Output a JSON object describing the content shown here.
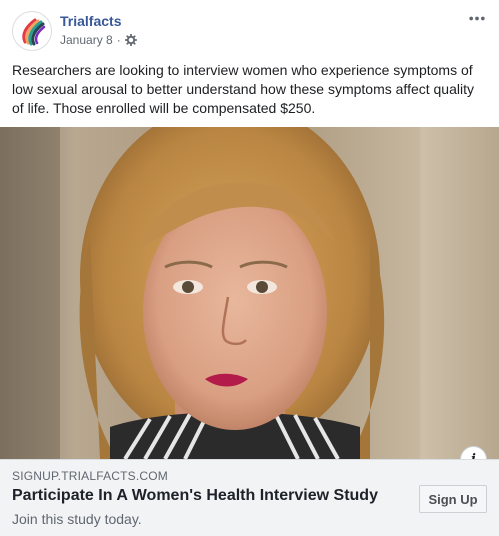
{
  "post": {
    "page_name": "Trialfacts",
    "date": "January 8",
    "separator": "·",
    "privacy_icon": "gear-icon",
    "more_icon": "more-options-icon",
    "text": "Researchers are looking to interview women who experience symptoms of low sexual arousal to better understand how these symptoms affect quality of life. Those enrolled will be compensated $250."
  },
  "image": {
    "subject": "woman-portrait-photo",
    "info_icon": "i"
  },
  "link_card": {
    "domain": "SIGNUP.TRIALFACTS.COM",
    "headline": "Participate In A Women's Health Interview Study",
    "description": "Join this study today.",
    "cta_label": "Sign Up"
  },
  "colors": {
    "page_name": "#385898",
    "card_bg": "#f2f3f5",
    "meta_text": "#606770"
  }
}
